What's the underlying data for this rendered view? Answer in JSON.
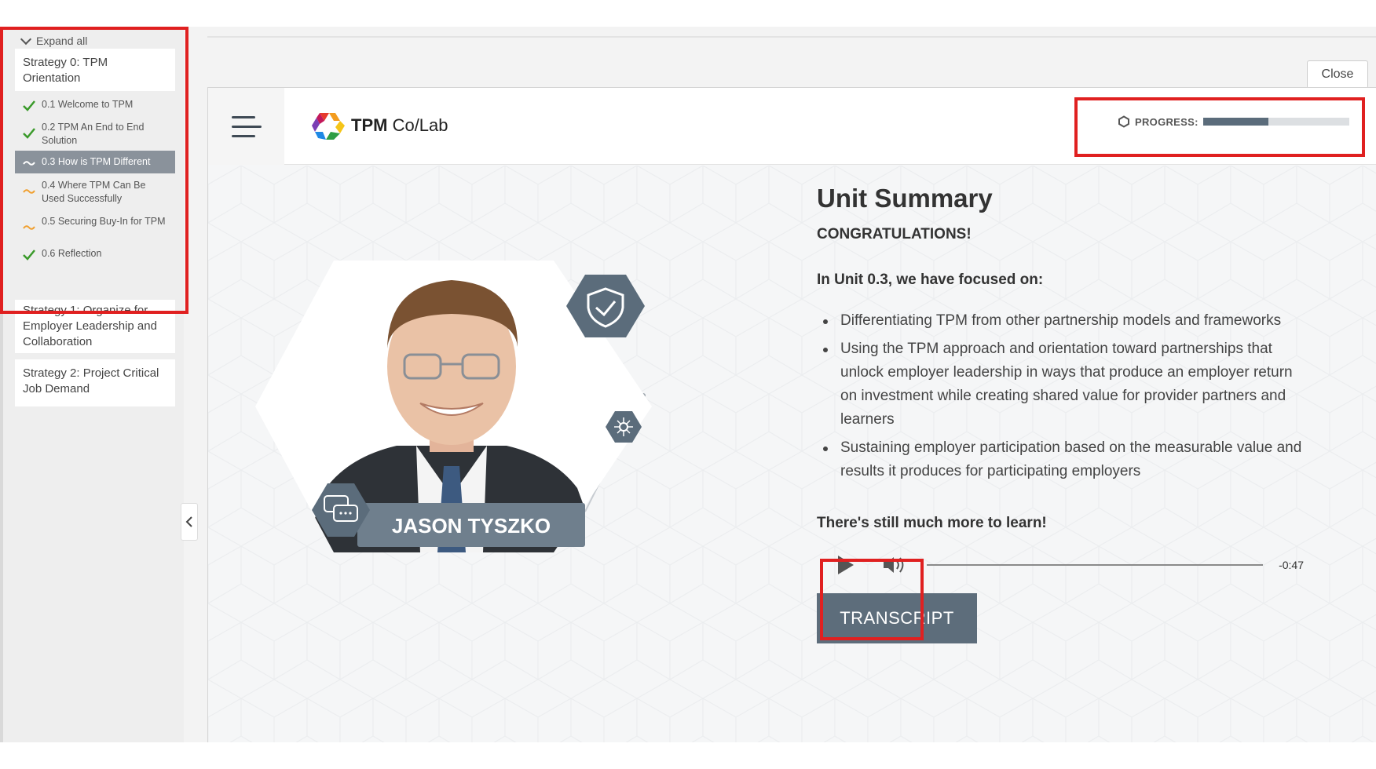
{
  "sidebar": {
    "expand_all": "Expand all",
    "strategies": [
      {
        "label": "Strategy 0: TPM Orientation"
      },
      {
        "label": "Strategy 1: Organize for Employer Leadership and Collaboration"
      },
      {
        "label": "Strategy 2: Project Critical Job Demand"
      }
    ],
    "units": [
      {
        "label": "0.1 Welcome to TPM",
        "status": "complete"
      },
      {
        "label": "0.2 TPM An End to End Solution",
        "status": "complete"
      },
      {
        "label": "0.3 How is TPM Different",
        "status": "current"
      },
      {
        "label": "0.4 Where TPM Can Be Used Successfully",
        "status": "in-progress"
      },
      {
        "label": "0.5 Securing Buy-In for TPM",
        "status": "in-progress"
      },
      {
        "label": "0.6 Reflection",
        "status": "complete"
      }
    ]
  },
  "window": {
    "close_label": "Close"
  },
  "header": {
    "logo_bold": "TPM",
    "logo_rest": " Co/Lab",
    "progress_label": "PROGRESS:",
    "progress_fraction": 0.45
  },
  "presenter": {
    "name": "JASON TYSZKO"
  },
  "summary": {
    "title": "Unit Summary",
    "congrats": "CONGRATULATIONS!",
    "intro": "In Unit 0.3, we have focused on:",
    "bullets": [
      "Differentiating TPM from other partnership models and frameworks",
      "Using the TPM approach and orientation toward partnerships that unlock employer leadership in ways that produce an employer return on investment while creating shared value for provider partners and learners",
      "Sustaining employer participation based on the measurable value and results it produces for participating employers"
    ],
    "more": "There's still much more to learn!",
    "time_remaining": "-0:47",
    "transcript_label": "TRANSCRIPT"
  },
  "colors": {
    "accent": "#5d6d7b",
    "highlight_box": "#e02020",
    "check": "#3a9a2a",
    "in_progress": "#f0a030"
  },
  "icons": {
    "expand": "chevron-down-icon",
    "complete": "checkmark-icon",
    "in_progress": "tilde-icon",
    "menu": "hamburger-icon",
    "progress": "hexagon-outline-icon",
    "play": "play-icon",
    "volume": "speaker-icon",
    "collapse": "chevron-left-icon",
    "shield": "shield-check-icon",
    "network": "network-hub-icon",
    "chat": "chat-bubbles-icon"
  }
}
